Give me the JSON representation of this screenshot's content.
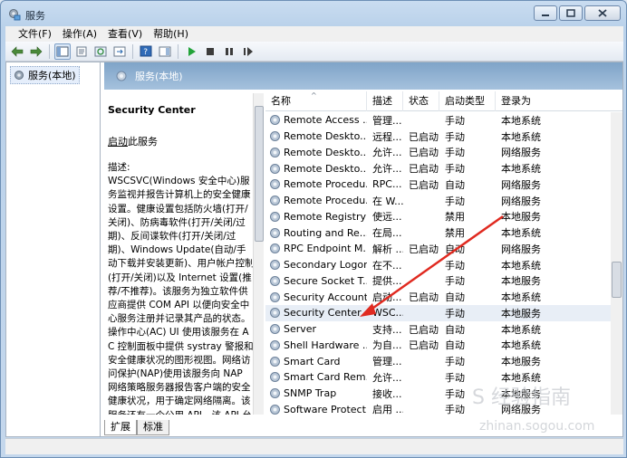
{
  "window": {
    "title": "服务"
  },
  "menu": [
    "文件(F)",
    "操作(A)",
    "查看(V)",
    "帮助(H)"
  ],
  "tree": {
    "root": "服务(本地)"
  },
  "panel_header": "服务(本地)",
  "detail": {
    "service_name": "Security Center",
    "start_link": "启动",
    "start_suffix": "此服务",
    "desc_label": "描述:",
    "desc_text": "WSCSVC(Windows 安全中心)服务监视并报告计算机上的安全健康设置。健康设置包括防火墙(打开/关闭)、防病毒软件(打开/关闭/过期)、反间谍软件(打开/关闭/过期)、Windows Update(自动/手动下载并安装更新)、用户帐户控制(打开/关闭)以及 Internet 设置(推荐/不推荐)。该服务为独立软件供应商提供 COM API 以便向安全中心服务注册并记录其产品的状态。操作中心(AC) UI 使用该服务在 AC 控制面板中提供 systray 警报和安全健康状况的图形视图。网络访问保护(NAP)使用该服务向 NAP 网络策略服务器报告客户端的安全健康状况，用于确定网络隔离。该服务还有一个公用 API，该 API 允许外部客户以编程方式检索"
  },
  "columns": {
    "name": "名称",
    "desc": "描述",
    "status": "状态",
    "startup": "启动类型",
    "logon": "登录为"
  },
  "services": [
    {
      "name": "Remote Access ...",
      "desc": "管理...",
      "status": "",
      "startup": "手动",
      "logon": "本地系统"
    },
    {
      "name": "Remote Deskto...",
      "desc": "远程...",
      "status": "已启动",
      "startup": "手动",
      "logon": "本地系统"
    },
    {
      "name": "Remote Deskto...",
      "desc": "允许...",
      "status": "已启动",
      "startup": "手动",
      "logon": "网络服务"
    },
    {
      "name": "Remote Deskto...",
      "desc": "允许...",
      "status": "已启动",
      "startup": "手动",
      "logon": "本地系统"
    },
    {
      "name": "Remote Procedu...",
      "desc": "RPC...",
      "status": "已启动",
      "startup": "自动",
      "logon": "网络服务"
    },
    {
      "name": "Remote Procedu...",
      "desc": "在 W...",
      "status": "",
      "startup": "手动",
      "logon": "网络服务"
    },
    {
      "name": "Remote Registry",
      "desc": "使远...",
      "status": "",
      "startup": "禁用",
      "logon": "本地服务"
    },
    {
      "name": "Routing and Re...",
      "desc": "在局...",
      "status": "",
      "startup": "禁用",
      "logon": "本地系统"
    },
    {
      "name": "RPC Endpoint M...",
      "desc": "解析 ...",
      "status": "已启动",
      "startup": "自动",
      "logon": "网络服务"
    },
    {
      "name": "Secondary Logon",
      "desc": "在不...",
      "status": "",
      "startup": "手动",
      "logon": "本地系统"
    },
    {
      "name": "Secure Socket T...",
      "desc": "提供...",
      "status": "",
      "startup": "手动",
      "logon": "本地服务"
    },
    {
      "name": "Security Account...",
      "desc": "启动...",
      "status": "已启动",
      "startup": "自动",
      "logon": "本地系统"
    },
    {
      "name": "Security Center",
      "desc": "WSC...",
      "status": "",
      "startup": "手动",
      "logon": "本地服务"
    },
    {
      "name": "Server",
      "desc": "支持...",
      "status": "已启动",
      "startup": "自动",
      "logon": "本地系统"
    },
    {
      "name": "Shell Hardware ...",
      "desc": "为自...",
      "status": "已启动",
      "startup": "自动",
      "logon": "本地系统"
    },
    {
      "name": "Smart Card",
      "desc": "管理...",
      "status": "",
      "startup": "手动",
      "logon": "本地服务"
    },
    {
      "name": "Smart Card Rem...",
      "desc": "允许...",
      "status": "",
      "startup": "手动",
      "logon": "本地系统"
    },
    {
      "name": "SNMP Trap",
      "desc": "接收...",
      "status": "",
      "startup": "手动",
      "logon": "本地服务"
    },
    {
      "name": "Software Protect...",
      "desc": "启用 ...",
      "status": "",
      "startup": "手动",
      "logon": "网络服务"
    }
  ],
  "tabs": [
    "扩展",
    "标准"
  ],
  "watermark": {
    "line1": "S 经验指南",
    "line2": "zhinan.sogou.com"
  }
}
